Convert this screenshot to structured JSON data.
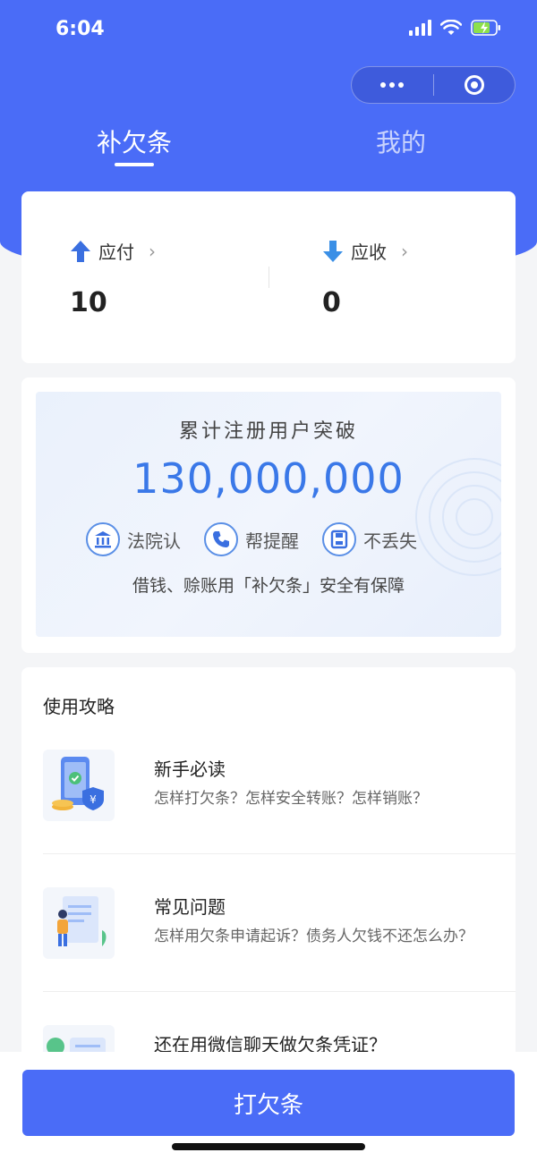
{
  "status_bar": {
    "time": "6:04"
  },
  "tabs": [
    {
      "label": "补欠条",
      "active": true
    },
    {
      "label": "我的",
      "active": false
    }
  ],
  "balance": {
    "payable": {
      "label": "应付",
      "value": "10"
    },
    "receivable": {
      "label": "应收",
      "value": "0"
    }
  },
  "promo": {
    "title": "累计注册用户突破",
    "number": "130,000,000",
    "features": [
      {
        "icon": "court-icon",
        "label": "法院认"
      },
      {
        "icon": "phone-icon",
        "label": "帮提醒"
      },
      {
        "icon": "save-icon",
        "label": "不丢失"
      }
    ],
    "subtitle": "借钱、赊账用「补欠条」安全有保障"
  },
  "guide": {
    "title": "使用攻略",
    "items": [
      {
        "title": "新手必读",
        "desc": "怎样打欠条？怎样安全转账？怎样销账？",
        "icon": "phone-shield-icon"
      },
      {
        "title": "常见问题",
        "desc": "怎样用欠条申请起诉？债务人欠钱不还怎么办？",
        "icon": "document-person-icon"
      },
      {
        "title": "还在用微信聊天做欠条凭证？",
        "desc": "",
        "icon": "chat-icon"
      }
    ]
  },
  "primary_action": {
    "label": "打欠条"
  },
  "colors": {
    "brand": "#4a6cf7",
    "accent_number": "#3a78e8",
    "background": "#f4f5f7"
  }
}
